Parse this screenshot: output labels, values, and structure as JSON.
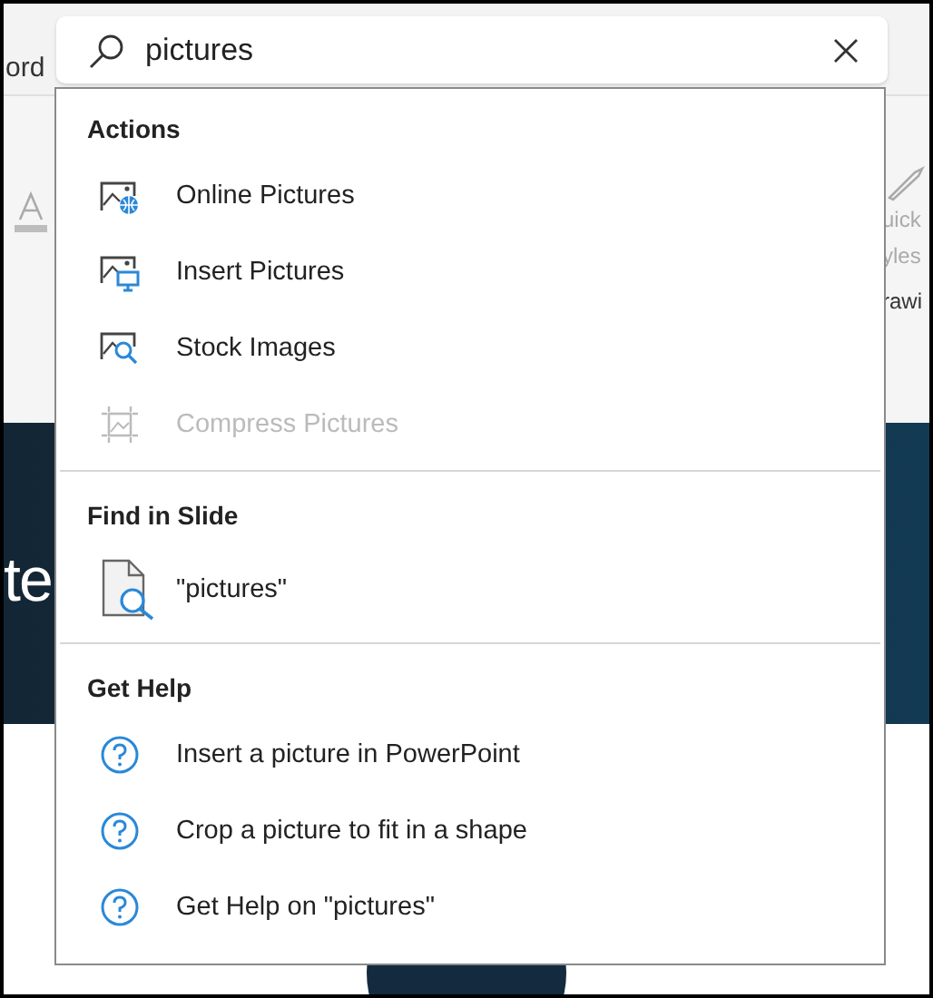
{
  "background": {
    "ribbon_fragments": [
      {
        "kind": "tab",
        "text": "ord"
      },
      {
        "kind": "faded",
        "text": "uick"
      },
      {
        "kind": "faded",
        "text": "yles"
      },
      {
        "kind": "group",
        "text": "rawi"
      }
    ],
    "slide_fragment": "te"
  },
  "search": {
    "value": "pictures"
  },
  "sections": [
    {
      "title": "Actions",
      "items": [
        {
          "kind": "online",
          "label": "Online Pictures",
          "disabled": false
        },
        {
          "kind": "insert",
          "label": "Insert Pictures",
          "disabled": false
        },
        {
          "kind": "stock",
          "label": "Stock Images",
          "disabled": false
        },
        {
          "kind": "compress",
          "label": "Compress Pictures",
          "disabled": true
        }
      ]
    },
    {
      "title": "Find in Slide",
      "items": [
        {
          "kind": "find",
          "label": "\"pictures\"",
          "disabled": false
        }
      ]
    },
    {
      "title": "Get Help",
      "items": [
        {
          "kind": "help",
          "label": "Insert a picture in PowerPoint",
          "disabled": false
        },
        {
          "kind": "help",
          "label": "Crop a picture to fit in a shape",
          "disabled": false
        },
        {
          "kind": "help",
          "label": "Get Help on \"pictures\"",
          "disabled": false
        }
      ]
    }
  ]
}
